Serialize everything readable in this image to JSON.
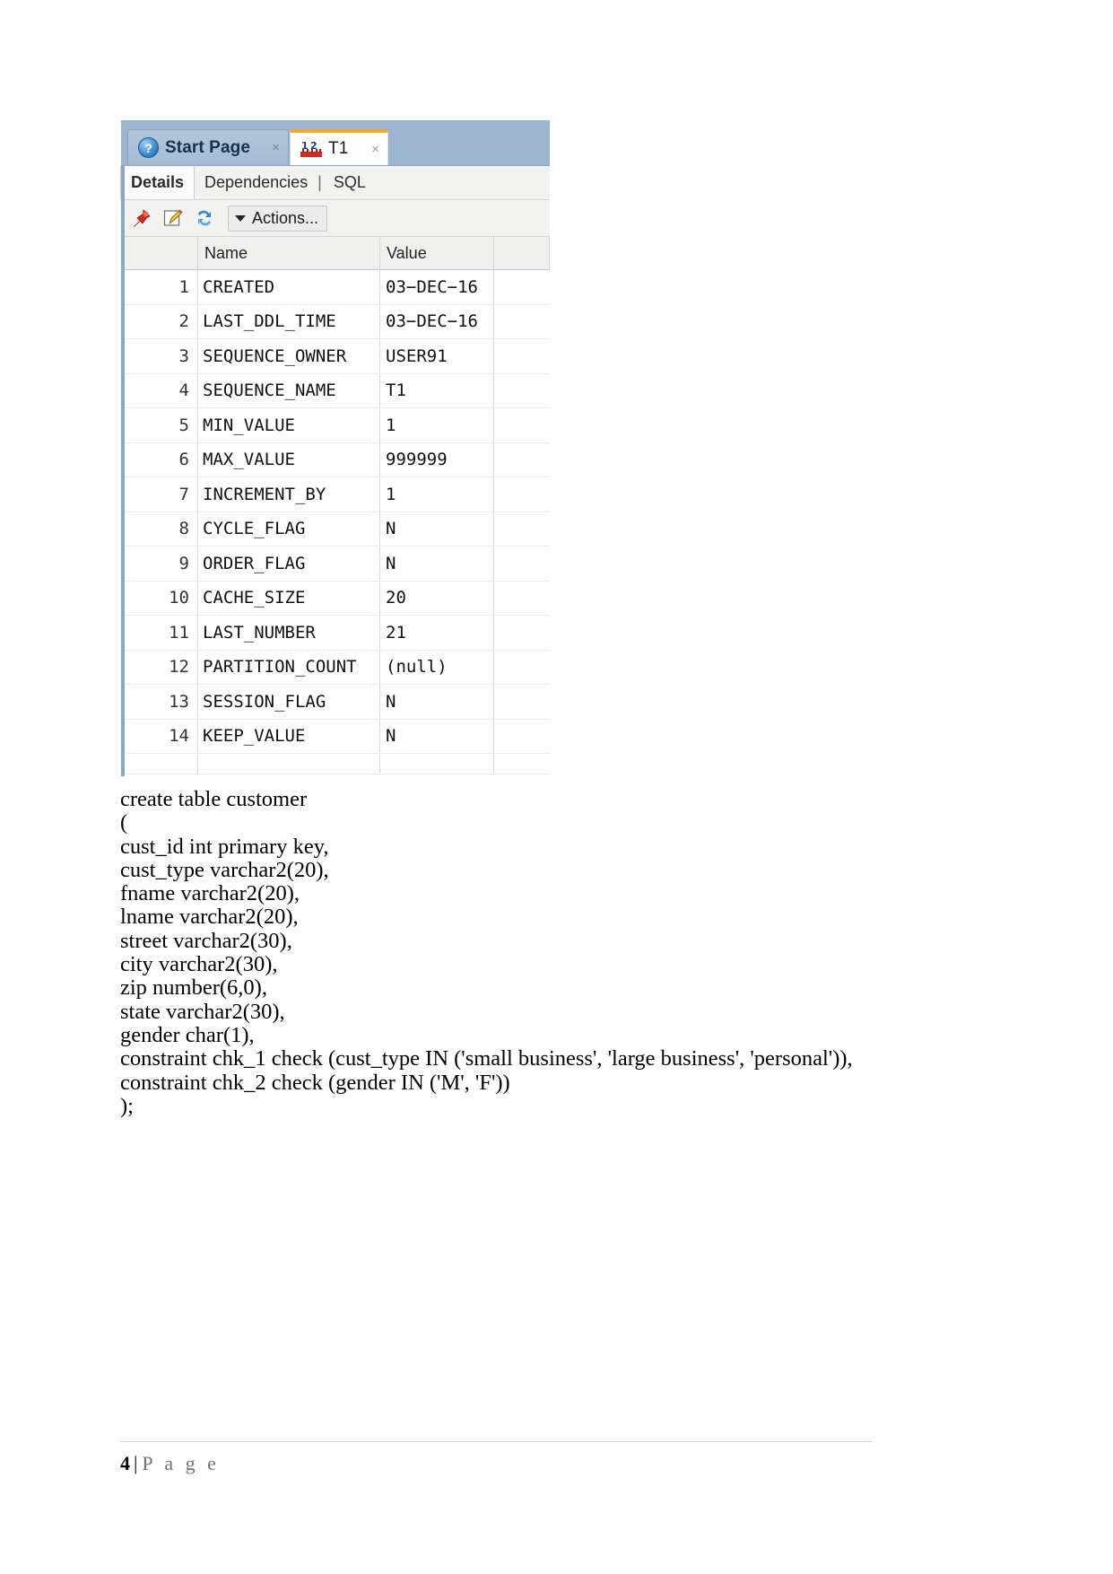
{
  "window": {
    "tabs": [
      {
        "label": "Start Page",
        "icon": "help-icon",
        "active": false,
        "close": "×"
      },
      {
        "label": "T1",
        "icon": "sequence-icon",
        "active": true,
        "close": "×"
      }
    ],
    "subtabs": [
      {
        "label": "Details",
        "selected": true
      },
      {
        "label": "Dependencies",
        "selected": false
      },
      {
        "label": "SQL",
        "selected": false
      }
    ],
    "subtab_separator": "|",
    "toolbar": {
      "icons": [
        "pin-icon",
        "edit-icon",
        "refresh-icon"
      ],
      "actions_label": "Actions...",
      "caret": "caret-down-icon"
    },
    "grid": {
      "columns": [
        "",
        "Name",
        "Value"
      ],
      "rows": [
        {
          "n": "1",
          "name": "CREATED",
          "value": "03−DEC−16"
        },
        {
          "n": "2",
          "name": "LAST_DDL_TIME",
          "value": "03−DEC−16"
        },
        {
          "n": "3",
          "name": "SEQUENCE_OWNER",
          "value": "USER91"
        },
        {
          "n": "4",
          "name": "SEQUENCE_NAME",
          "value": "T1"
        },
        {
          "n": "5",
          "name": "MIN_VALUE",
          "value": "1"
        },
        {
          "n": "6",
          "name": "MAX_VALUE",
          "value": "999999"
        },
        {
          "n": "7",
          "name": "INCREMENT_BY",
          "value": "1"
        },
        {
          "n": "8",
          "name": "CYCLE_FLAG",
          "value": "N"
        },
        {
          "n": "9",
          "name": "ORDER_FLAG",
          "value": "N"
        },
        {
          "n": "10",
          "name": "CACHE_SIZE",
          "value": "20"
        },
        {
          "n": "11",
          "name": "LAST_NUMBER",
          "value": "21"
        },
        {
          "n": "12",
          "name": "PARTITION_COUNT",
          "value": "(null)"
        },
        {
          "n": "13",
          "name": "SESSION_FLAG",
          "value": "N"
        },
        {
          "n": "14",
          "name": "KEEP_VALUE",
          "value": "N"
        }
      ]
    }
  },
  "sql_block": "create table customer\n(\ncust_id int primary key,\ncust_type varchar2(20),\nfname varchar2(20),\nlname varchar2(20),\nstreet varchar2(30),\ncity varchar2(30),\nzip number(6,0),\nstate varchar2(30),\ngender char(1),\nconstraint chk_1 check (cust_type IN ('small business', 'large business', 'personal')),\nconstraint chk_2 check (gender IN ('M', 'F'))\n);",
  "footer": {
    "page_number": "4",
    "separator": "|",
    "label": "P a g e"
  },
  "colors": {
    "tabstrip_bg": "#9db4cd",
    "active_tab_accent": "#f0a830",
    "toolbar_bg": "#f2f2f1",
    "grid_header_bg": "#f0f0ee"
  }
}
